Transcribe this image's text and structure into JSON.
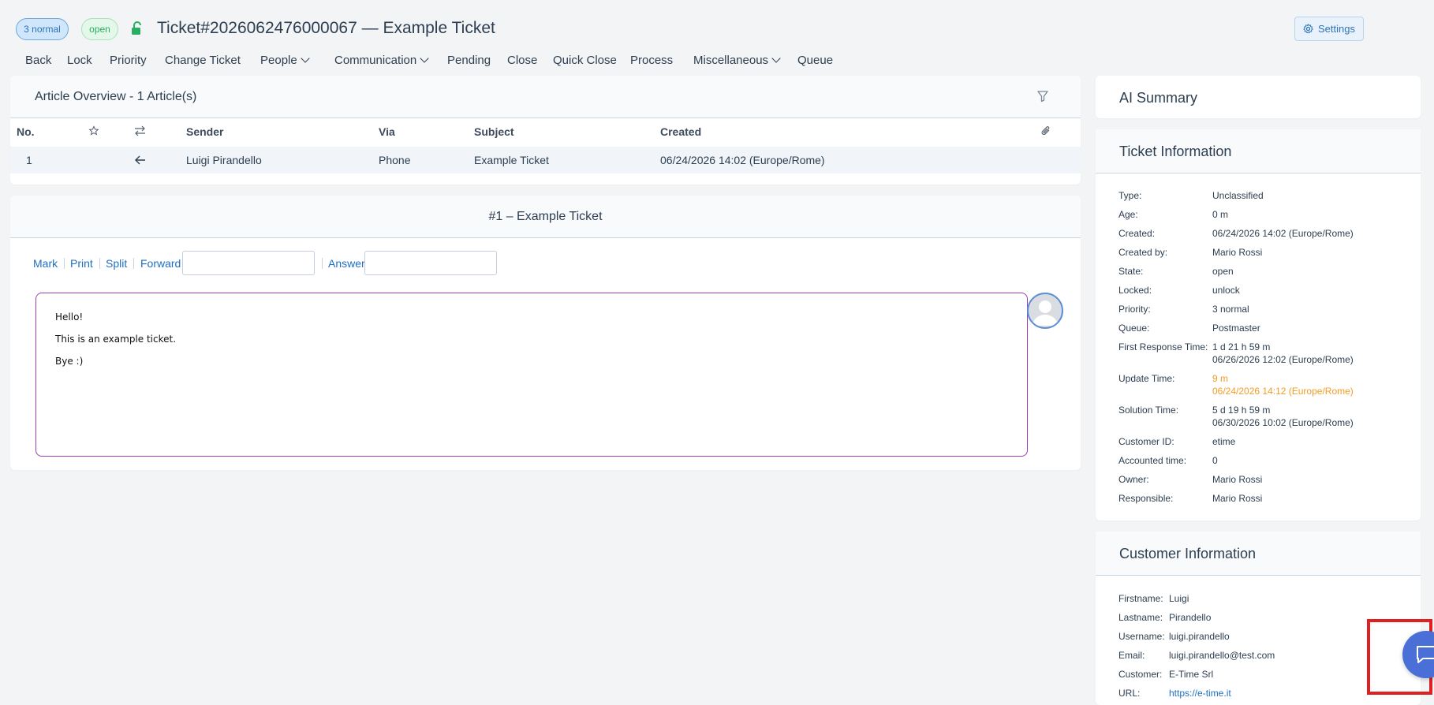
{
  "header": {
    "priority_badge": "3 normal",
    "state_badge": "open",
    "title": "Ticket#2026062476000067 — Example Ticket",
    "settings_label": "Settings"
  },
  "menu": {
    "back": "Back",
    "lock": "Lock",
    "priority": "Priority",
    "change_ticket": "Change Ticket",
    "people": "People",
    "communication": "Communication",
    "pending": "Pending",
    "close": "Close",
    "quick_close": "Quick Close",
    "process": "Process",
    "miscellaneous": "Miscellaneous",
    "queue": "Queue"
  },
  "overview": {
    "title": "Article Overview - 1 Article(s)",
    "columns": {
      "no": "No.",
      "sender": "Sender",
      "via": "Via",
      "subject": "Subject",
      "created": "Created"
    },
    "rows": [
      {
        "no": "1",
        "sender": "Luigi Pirandello",
        "via": "Phone",
        "subject": "Example Ticket",
        "created": "06/24/2026 14:02 (Europe/Rome)"
      }
    ]
  },
  "article": {
    "title": "#1 – Example Ticket",
    "actions": {
      "mark": "Mark",
      "print": "Print",
      "split": "Split",
      "forward": "Forward",
      "answer": "Answer"
    },
    "body": {
      "line1": "Hello!",
      "line2": "This is an example ticket.",
      "line3": "Bye :)"
    }
  },
  "sidebar": {
    "ai_summary_title": "AI Summary",
    "ticket_info_title": "Ticket Information",
    "ticket_info": [
      {
        "k": "Type:",
        "v": "Unclassified"
      },
      {
        "k": "Age:",
        "v": "0 m"
      },
      {
        "k": "Created:",
        "v": "06/24/2026 14:02 (Europe/Rome)"
      },
      {
        "k": "Created by:",
        "v": "Mario Rossi"
      },
      {
        "k": "State:",
        "v": "open"
      },
      {
        "k": "Locked:",
        "v": "unlock"
      },
      {
        "k": "Priority:",
        "v": "3 normal"
      },
      {
        "k": "Queue:",
        "v": "Postmaster"
      },
      {
        "k": "First Response Time:",
        "v": "1 d 21 h 59 m",
        "v2": "06/26/2026 12:02 (Europe/Rome)"
      },
      {
        "k": "Update Time:",
        "v": "9 m",
        "v2": "06/24/2026 14:12 (Europe/Rome)"
      },
      {
        "k": "Solution Time:",
        "v": "5 d 19 h 59 m",
        "v2": "06/30/2026 10:02 (Europe/Rome)"
      },
      {
        "k": "Customer ID:",
        "v": "etime"
      },
      {
        "k": "Accounted time:",
        "v": "0"
      },
      {
        "k": "Owner:",
        "v": "Mario Rossi"
      },
      {
        "k": "Responsible:",
        "v": "Mario Rossi"
      }
    ],
    "customer_info_title": "Customer Information",
    "customer_info": [
      {
        "k": "Firstname:",
        "v": "Luigi"
      },
      {
        "k": "Lastname:",
        "v": "Pirandello"
      },
      {
        "k": "Username:",
        "v": "luigi.pirandello"
      },
      {
        "k": "Email:",
        "v": "luigi.pirandello@test.com"
      },
      {
        "k": "Customer:",
        "v": "E-Time Srl"
      },
      {
        "k": "URL:",
        "v": "https://e-time.it"
      }
    ]
  },
  "colors": {
    "accent": "#1e6fc3",
    "warning": "#f39c26",
    "fab": "#4a6fd6",
    "highlight": "#e02020"
  }
}
